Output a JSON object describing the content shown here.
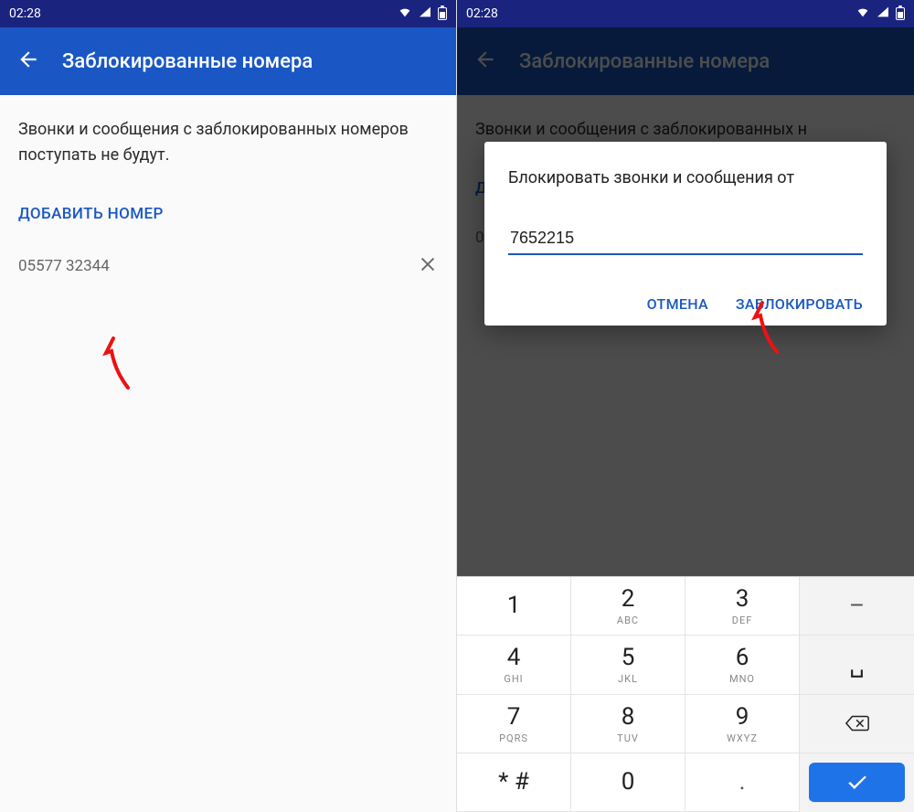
{
  "status": {
    "time": "02:28"
  },
  "left": {
    "title": "Заблокированные номера",
    "desc": "Звонки и сообщения с заблокированных номеров поступать не будут.",
    "add_label": "ДОБАВИТЬ НОМЕР",
    "numbers": [
      "05577 32344"
    ]
  },
  "right": {
    "title": "Заблокированные номера",
    "desc": "Звонки и сообщения с заблокированных н",
    "add_partial": "Д",
    "num_partial": "0",
    "dialog": {
      "title": "Блокировать звонки и сообщения от",
      "input_value": "7652215",
      "cancel": "ОТМЕНА",
      "confirm": "ЗАБЛОКИРОВАТЬ"
    },
    "keypad": {
      "k1": {
        "d": "1",
        "l": ""
      },
      "k2": {
        "d": "2",
        "l": "ABC"
      },
      "k3": {
        "d": "3",
        "l": "DEF"
      },
      "k4": {
        "d": "4",
        "l": "GHI"
      },
      "k5": {
        "d": "5",
        "l": "JKL"
      },
      "k6": {
        "d": "6",
        "l": "MNO"
      },
      "k7": {
        "d": "7",
        "l": "PQRS"
      },
      "k8": {
        "d": "8",
        "l": "TUV"
      },
      "k9": {
        "d": "9",
        "l": "WXYZ"
      },
      "k0": {
        "d": "0",
        "l": ""
      },
      "star": "* #",
      "dot": ".",
      "minus": "–"
    }
  }
}
